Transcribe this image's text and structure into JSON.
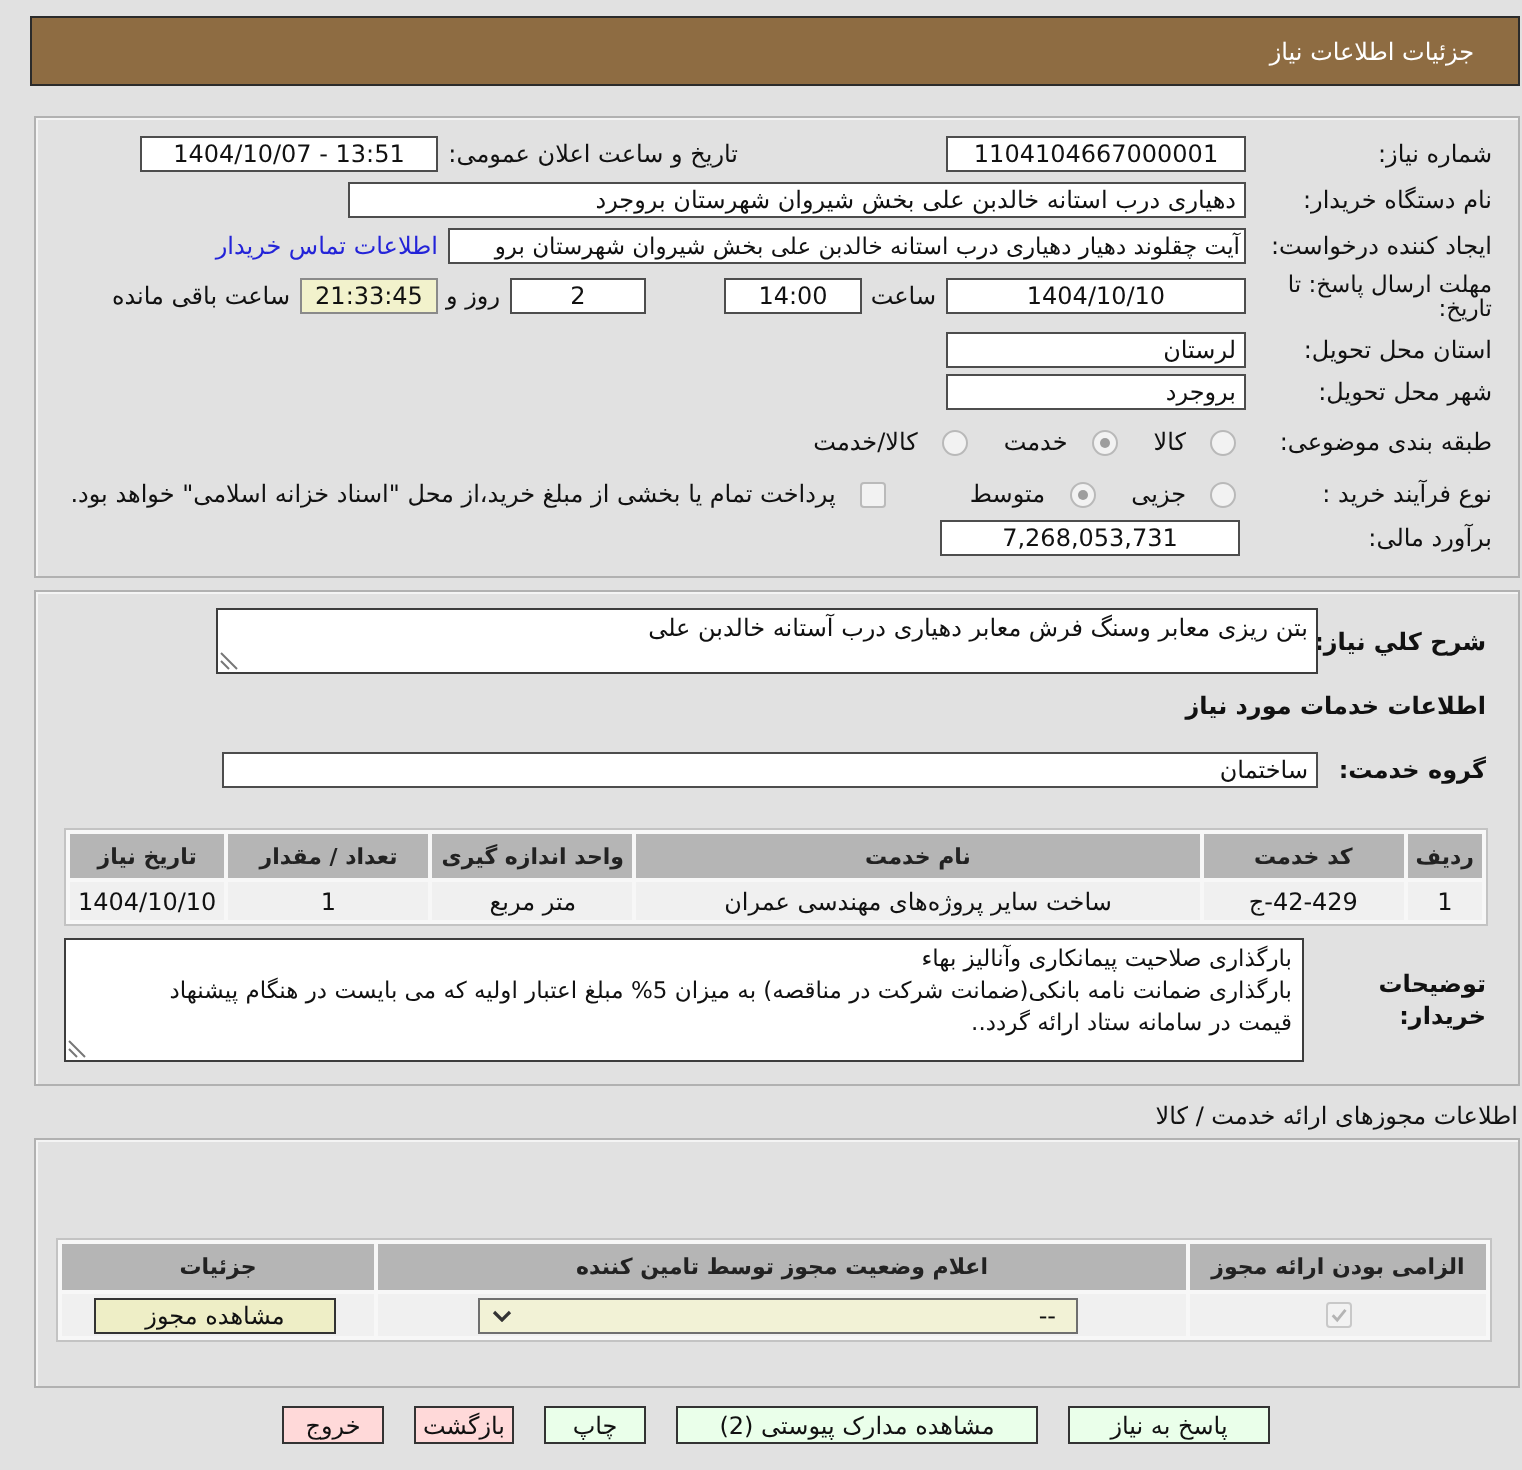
{
  "header": {
    "title": "جزئیات اطلاعات نیاز"
  },
  "need_info": {
    "need_number": {
      "label": "شماره نیاز:",
      "value": "1104104667000001"
    },
    "announcement": {
      "label": "تاریخ و ساعت اعلان عمومی:",
      "value": "1404/10/07 - 13:51"
    },
    "buyer_organization": {
      "label": "نام دستگاه خریدار:",
      "value": "دهیاری درب استانه خالدبن علی بخش شیروان شهرستان بروجرد"
    },
    "requester": {
      "label": "ایجاد کننده درخواست:",
      "value": "آیت چقلوند دهیار دهیاری درب استانه خالدبن علی بخش شیروان شهرستان برو",
      "contact_link": "اطلاعات تماس خریدار"
    },
    "deadline": {
      "label": "مهلت ارسال پاسخ: تا تاریخ:",
      "date": "1404/10/10",
      "time_label": "ساعت",
      "time": "14:00",
      "days": "2",
      "days_label": "روز و",
      "remaining": "21:33:45",
      "remaining_label": "ساعت باقی مانده"
    },
    "delivery_province": {
      "label": "استان محل تحویل:",
      "value": "لرستان"
    },
    "delivery_city": {
      "label": "شهر محل تحویل:",
      "value": "بروجرد"
    },
    "category": {
      "label": "طبقه بندی موضوعی:",
      "options": [
        {
          "label": "کالا",
          "selected": false
        },
        {
          "label": "خدمت",
          "selected": true
        },
        {
          "label": "کالا/خدمت",
          "selected": false
        }
      ]
    },
    "purchase_process": {
      "label": "نوع فرآیند خرید :",
      "options": [
        {
          "label": "جزیی",
          "selected": false
        },
        {
          "label": "متوسط",
          "selected": true
        }
      ],
      "treasury_payment": {
        "label": "پرداخت تمام یا بخشی از مبلغ خرید،از محل \"اسناد خزانه اسلامی\" خواهد بود.",
        "checked": false
      }
    },
    "budget": {
      "label": "برآورد مالی:",
      "value": "7,268,053,731"
    }
  },
  "need_description": {
    "summary": {
      "label": "شرح کلي نياز:",
      "value": "بتن ریزی معابر وسنگ فرش معابر دهیاری درب آستانه خالدبن علی"
    },
    "services_heading": "اطلاعات خدمات مورد نیاز",
    "service_group": {
      "label": "گروه خدمت:",
      "value": "ساختمان"
    },
    "services_table": {
      "columns": [
        "ردیف",
        "کد خدمت",
        "نام خدمت",
        "واحد اندازه گیری",
        "تعداد / مقدار",
        "تاریخ نیاز"
      ],
      "rows": [
        [
          "1",
          "42-429-ج",
          "ساخت سایر پروژه‌های مهندسی عمران",
          "متر مربع",
          "1",
          "1404/10/10"
        ]
      ]
    },
    "buyer_notes": {
      "label": "توضیحات خریدار:",
      "value": "بارگذاری صلاحیت پیمانکاری وآنالیز بهاء\nبارگذاری ضمانت نامه بانکی(ضمانت شرکت در مناقصه) به میزان 5% مبلغ اعتبار اولیه که می بایست در هنگام پیشنهاد\nقیمت در سامانه ستاد ارائه گردد.."
    }
  },
  "licenses": {
    "heading": "اطلاعات مجوزهای ارائه خدمت / کالا",
    "columns": [
      "الزامی بودن ارائه مجوز",
      "اعلام وضعیت مجوز توسط تامین کننده",
      "جزئیات"
    ],
    "rows": [
      {
        "required": true,
        "status": "--",
        "action": "مشاهده مجوز"
      }
    ]
  },
  "actions": [
    {
      "label": "پاسخ به نیاز",
      "kind": "action"
    },
    {
      "label": "مشاهده مدارک پیوستی (2)",
      "kind": "action"
    },
    {
      "label": "چاپ",
      "kind": "action"
    },
    {
      "label": "بازگشت",
      "kind": "exit"
    },
    {
      "label": "خروج",
      "kind": "exit"
    }
  ]
}
